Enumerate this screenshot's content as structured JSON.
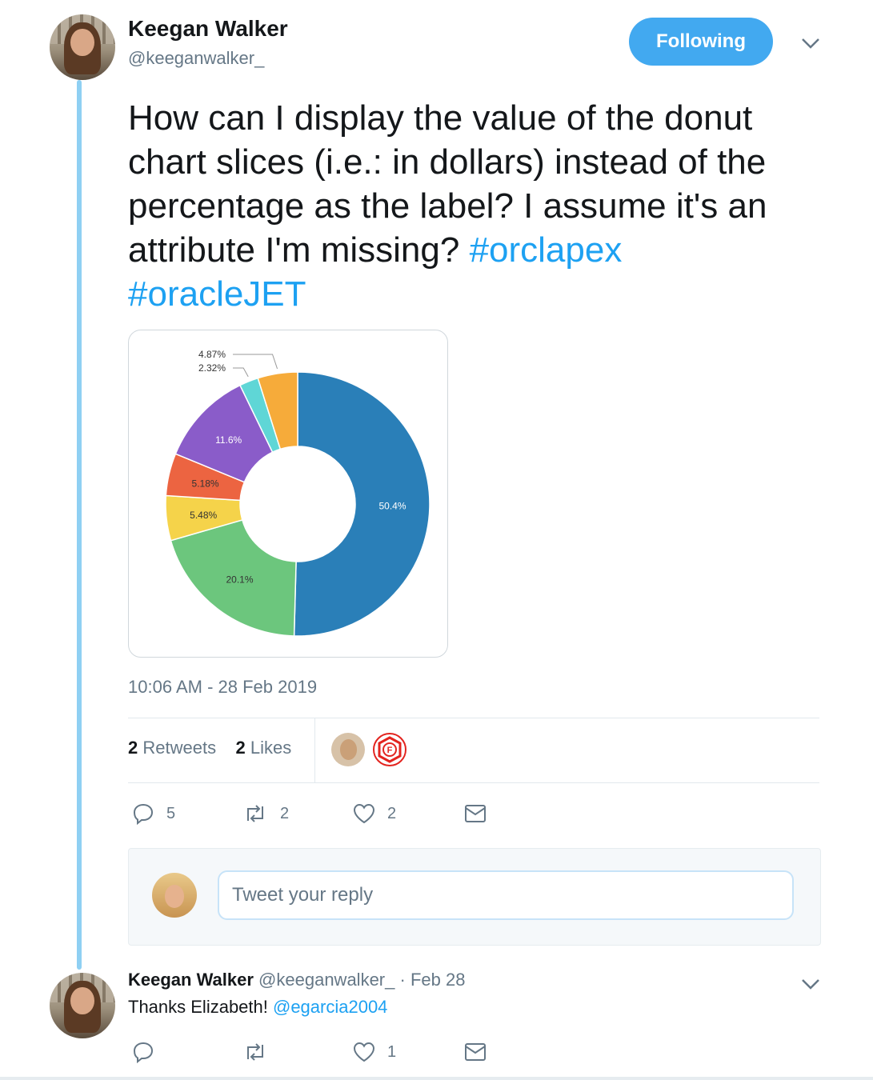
{
  "tweet": {
    "author_name": "Keegan Walker",
    "author_handle": "@keeganwalker_",
    "follow_button": "Following",
    "text_main": "How can I display the value of the donut chart slices (i.e.: in dollars) instead of the percentage as the label?  I assume it's an attribute I'm missing? ",
    "hashtag_1": "#orclapex",
    "hashtag_2": "#oracleJET",
    "timestamp": "10:06 AM - 28 Feb 2019",
    "retweets_count": "2",
    "retweets_label": "Retweets",
    "likes_count": "2",
    "likes_label": "Likes",
    "reply_count": "5",
    "retweet_count": "2",
    "like_count": "2"
  },
  "chart_data": {
    "type": "pie",
    "variant": "donut",
    "slices": [
      {
        "label": "50.4%",
        "value": 50.4,
        "color": "#2a7fb8"
      },
      {
        "label": "20.1%",
        "value": 20.1,
        "color": "#6cc67d"
      },
      {
        "label": "5.48%",
        "value": 5.48,
        "color": "#f5d34a"
      },
      {
        "label": "5.18%",
        "value": 5.18,
        "color": "#ec6441"
      },
      {
        "label": "11.6%",
        "value": 11.6,
        "color": "#8a5cc9"
      },
      {
        "label": "2.32%",
        "value": 2.32,
        "color": "#5fd6d6"
      },
      {
        "label": "4.87%",
        "value": 4.87,
        "color": "#f6ab3a"
      }
    ]
  },
  "liker_icons": [
    "user-avatar",
    "f-logo-icon"
  ],
  "reply_composer": {
    "placeholder": "Tweet your reply"
  },
  "reply": {
    "author_name": "Keegan Walker",
    "author_handle": "@keeganwalker_",
    "date": "· Feb 28",
    "text": "Thanks Elizabeth! ",
    "mention": "@egarcia2004",
    "like_count": "1"
  },
  "colors": {
    "accent": "#1da1f2",
    "follow_button_bg": "#42a9f0",
    "thread_line": "#8fd0f3",
    "muted_text": "#657786"
  }
}
